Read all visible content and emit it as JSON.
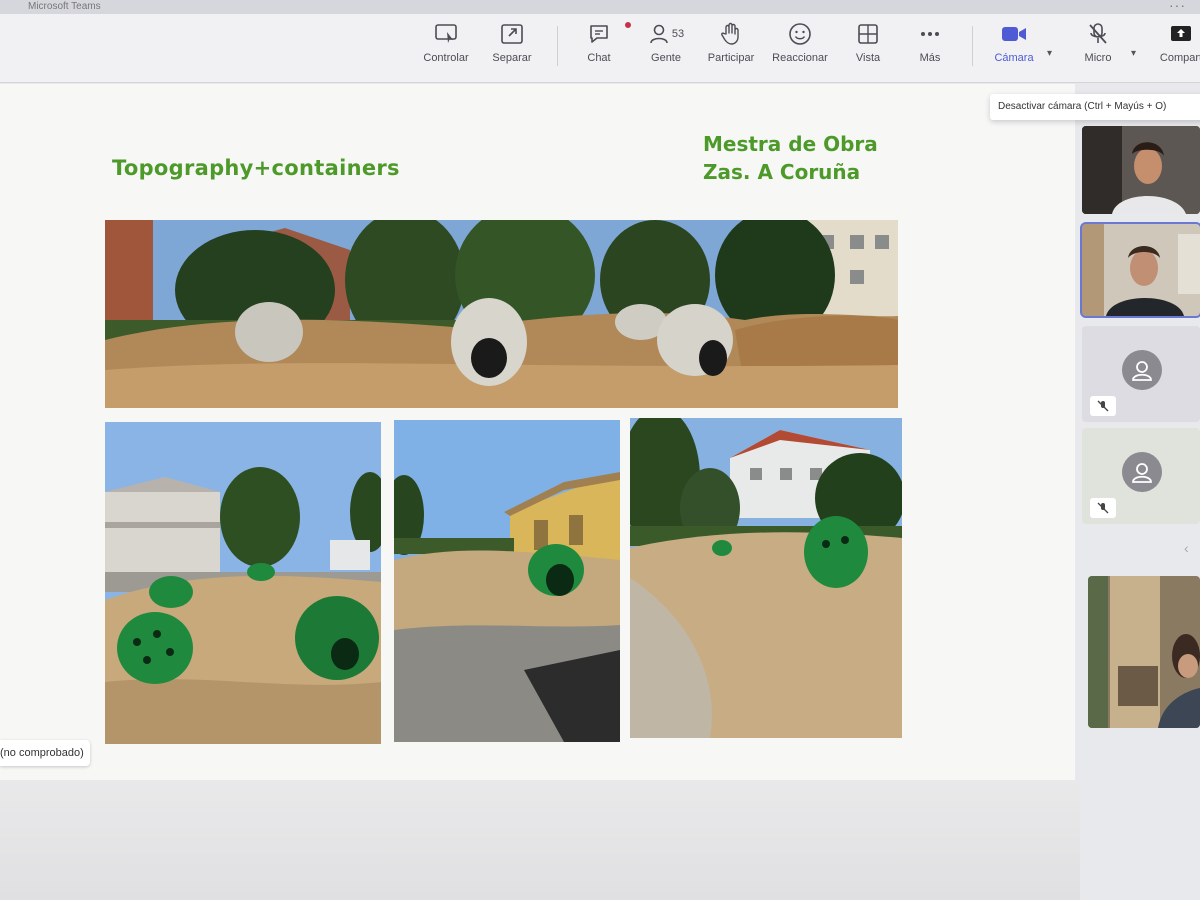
{
  "window": {
    "title": "Microsoft Teams"
  },
  "toolbar": {
    "controlar": "Controlar",
    "separar": "Separar",
    "chat": "Chat",
    "gente": "Gente",
    "people_count": "53",
    "participar": "Participar",
    "reaccionar": "Reaccionar",
    "vista": "Vista",
    "mas": "Más",
    "camara": "Cámara",
    "micro": "Micro",
    "compartir": "Compart"
  },
  "tooltip": {
    "text": "Desactivar cámara (Ctrl + Mayús + O)"
  },
  "slide": {
    "title": "Topography+containers",
    "subtitle_line1": "Mestra de Obra",
    "subtitle_line2": "Zas. A Coruña"
  },
  "status": {
    "unverified": "(no comprobado)"
  },
  "colors": {
    "slide_title_green": "#4d9a2a",
    "camera_active": "#4f5bd5",
    "tile_selected": "#6a78d1"
  }
}
